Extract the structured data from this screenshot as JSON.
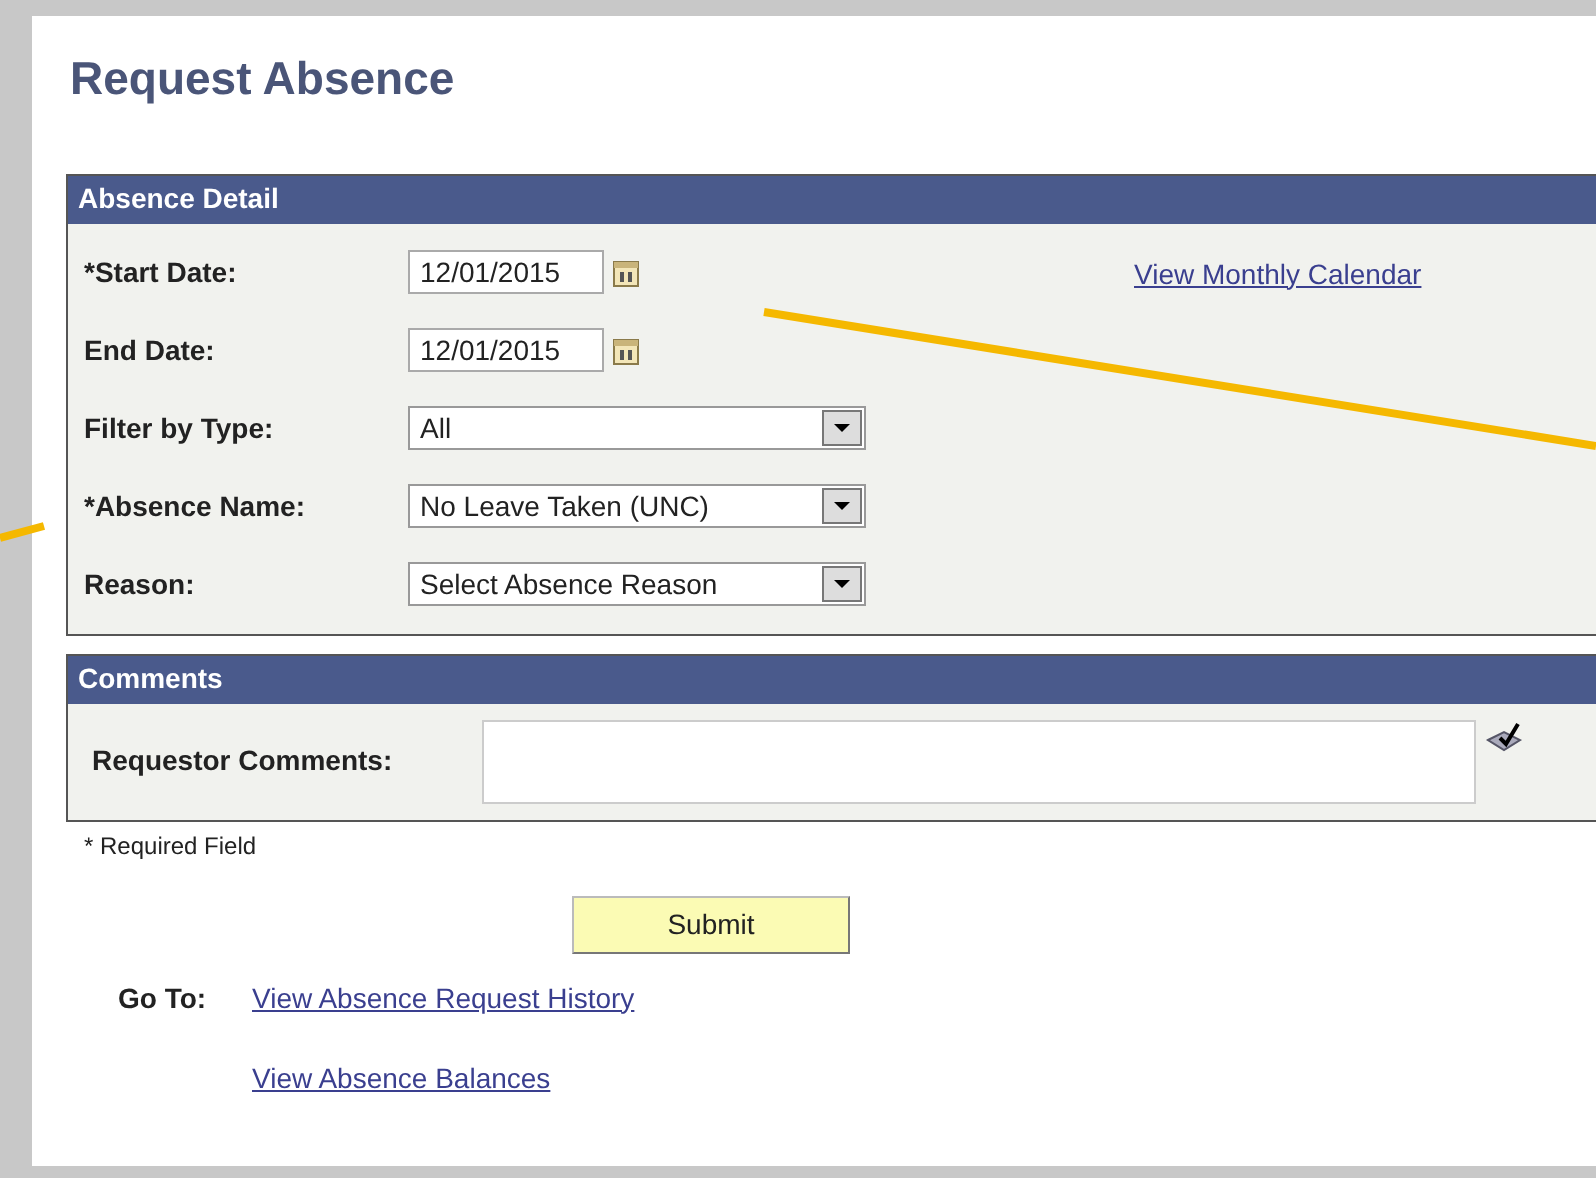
{
  "title": "Request Absence",
  "absence_detail": {
    "heading": "Absence Detail",
    "fields": [
      {
        "kind": "date",
        "label": "*Start Date:",
        "value": "12/01/2015"
      },
      {
        "kind": "date",
        "label": "End Date:",
        "value": "12/01/2015"
      },
      {
        "kind": "select",
        "label": "Filter by Type:",
        "value": "All"
      },
      {
        "kind": "select",
        "label": "*Absence Name:",
        "value": "No Leave Taken (UNC)"
      },
      {
        "kind": "select",
        "label": "Reason:",
        "value": "Select Absence Reason"
      }
    ],
    "calendar_link": "View Monthly Calendar"
  },
  "comments": {
    "heading": "Comments",
    "label": "Requestor Comments:"
  },
  "required_note": "* Required Field",
  "submit": "Submit",
  "goto": {
    "label": "Go To:",
    "links": [
      "View Absence Request History",
      "View Absence Balances"
    ]
  }
}
